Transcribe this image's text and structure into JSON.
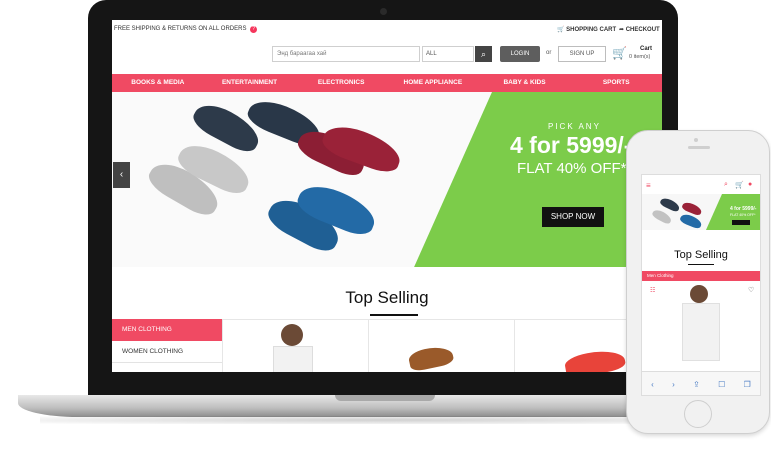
{
  "site": {
    "topbar": {
      "shipping_text": "FREE SHIPPING & RETURNS ON ALL ORDERS",
      "shipping_badge": "?",
      "shopping_cart": "SHOPPING CART",
      "checkout": "CHECKOUT"
    },
    "search": {
      "placeholder": "Энд бараагаа хай",
      "category": "ALL"
    },
    "auth": {
      "login": "LOGIN",
      "or": "or",
      "signup": "SIGN UP"
    },
    "cart": {
      "label": "Cart",
      "count": "0 item(s)"
    },
    "nav": [
      "BOOKS & MEDIA",
      "ENTERTAINMENT",
      "ELECTRONICS",
      "HOME APPLIANCE",
      "BABY & KIDS",
      "SPORTS"
    ],
    "hero": {
      "pick_any": "PICK ANY",
      "deal": "4 for 5999/-",
      "flat": "FLAT 40% OFF*",
      "cta": "SHOP NOW",
      "prev_arrow": "‹"
    },
    "top_selling": {
      "title": "Top Selling",
      "categories": [
        "MEN CLOTHING",
        "WOMEN CLOTHING"
      ]
    }
  },
  "phone": {
    "banner_deal": "4 for 5999/-",
    "banner_flat": "FLAT 40% OFF*",
    "title": "Top Selling",
    "tab": "Men Clothing"
  },
  "colors": {
    "accent": "#f04a63",
    "promo_green": "#7ccc4a",
    "dark": "#151515"
  }
}
